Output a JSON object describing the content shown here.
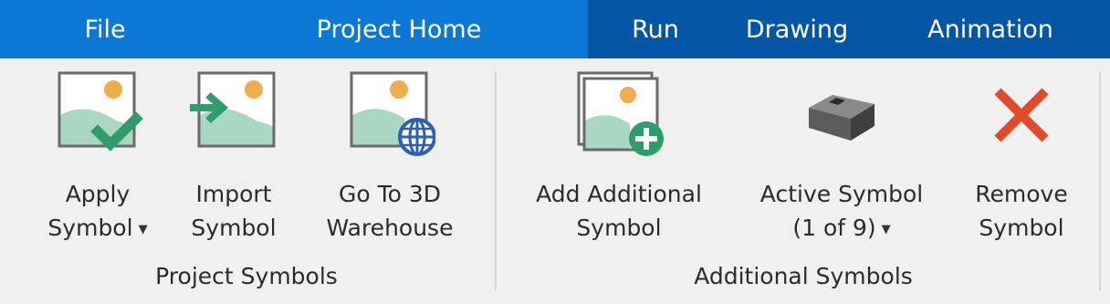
{
  "tabs": [
    {
      "label": "File"
    },
    {
      "label": "Project Home"
    },
    {
      "label": "Run"
    },
    {
      "label": "Drawing"
    },
    {
      "label": "Animation"
    }
  ],
  "groups": {
    "project_symbols": {
      "label": "Project Symbols",
      "buttons": {
        "apply": {
          "line1": "Apply",
          "line2": "Symbol",
          "icon": "apply-symbol-icon"
        },
        "import": {
          "line1": "Import",
          "line2": "Symbol",
          "icon": "import-symbol-icon"
        },
        "warehouse": {
          "line1": "Go To 3D",
          "line2": "Warehouse",
          "icon": "3d-warehouse-icon"
        }
      }
    },
    "additional_symbols": {
      "label": "Additional Symbols",
      "buttons": {
        "add": {
          "line1": "Add Additional",
          "line2": "Symbol",
          "icon": "add-symbol-icon"
        },
        "active": {
          "line1": "Active Symbol",
          "line2": "(1 of 9)",
          "icon": "active-symbol-icon"
        },
        "remove": {
          "line1": "Remove",
          "line2": "Symbol",
          "icon": "remove-x-icon"
        }
      }
    }
  },
  "colors": {
    "tab_blue": "#0a78d4",
    "tab_dark": "#0356a3",
    "landscape_green": "#a9d7c1",
    "sun_orange": "#f0ad4e",
    "check_green": "#2e9c6b",
    "remove_red": "#e04b2c"
  }
}
